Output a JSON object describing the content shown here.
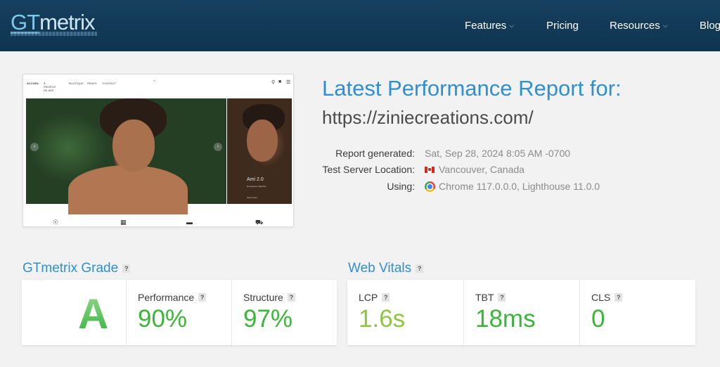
{
  "header": {
    "logo_gt": "GT",
    "logo_metrix": "metrix",
    "nav": [
      {
        "label": "Features",
        "has_dropdown": true
      },
      {
        "label": "Pricing",
        "has_dropdown": false
      },
      {
        "label": "Resources",
        "has_dropdown": true
      },
      {
        "label": "Blog",
        "has_dropdown": false
      }
    ]
  },
  "thumbnail": {
    "nav_items": [
      "ACCUEIL",
      "À PROPOS DE MOI",
      "BOUTIQUE",
      "PAGES",
      "CONTACT"
    ],
    "slide_caption": "Ami 2.0",
    "slide_subcaption": "Nouveauté collection",
    "slide_link": "Savoir plus"
  },
  "report": {
    "title": "Latest Performance Report for:",
    "url": "https://ziniecreations.com/",
    "meta": [
      {
        "label": "Report generated:",
        "value": "Sat, Sep 28, 2024 8:05 AM -0700"
      },
      {
        "label": "Test Server Location:",
        "value": "Vancouver, Canada",
        "icon": "canada-flag-icon"
      },
      {
        "label": "Using:",
        "value": "Chrome 117.0.0.0, Lighthouse 11.0.0",
        "icon": "chrome-icon"
      }
    ]
  },
  "grade": {
    "title": "GTmetrix Grade",
    "letter": "A",
    "performance_label": "Performance",
    "performance_value": "90%",
    "structure_label": "Structure",
    "structure_value": "97%"
  },
  "vitals": {
    "title": "Web Vitals",
    "lcp_label": "LCP",
    "lcp_value": "1.6s",
    "tbt_label": "TBT",
    "tbt_value": "18ms",
    "cls_label": "CLS",
    "cls_value": "0"
  },
  "colors": {
    "header_bg": "#16405f",
    "accent_blue": "#2e8fd1",
    "green": "#3bb53a",
    "light_green": "#8dc63f"
  }
}
